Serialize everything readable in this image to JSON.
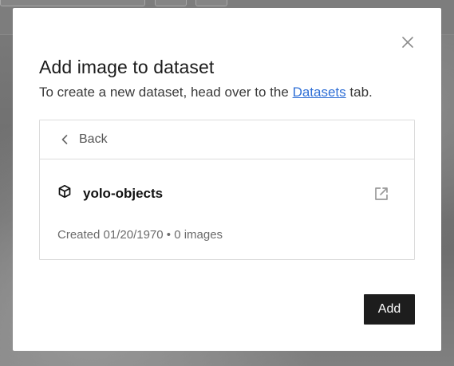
{
  "modal": {
    "title": "Add image to dataset",
    "subtitle_prefix": "To create a new dataset, head over to the",
    "subtitle_link": "Datasets",
    "subtitle_suffix": "tab.",
    "close_icon": "close-icon"
  },
  "panel": {
    "back_label": "Back",
    "back_icon": "chevron-left-icon",
    "dataset": {
      "icon": "cube-icon",
      "name": "yolo-objects",
      "open_icon": "external-link-icon",
      "meta": "Created 01/20/1970 • 0 images"
    }
  },
  "footer": {
    "add_label": "Add"
  },
  "colors": {
    "link": "#2f6fd6",
    "primary_button": "#1d1d1d",
    "backdrop": "#6f6f6f"
  }
}
